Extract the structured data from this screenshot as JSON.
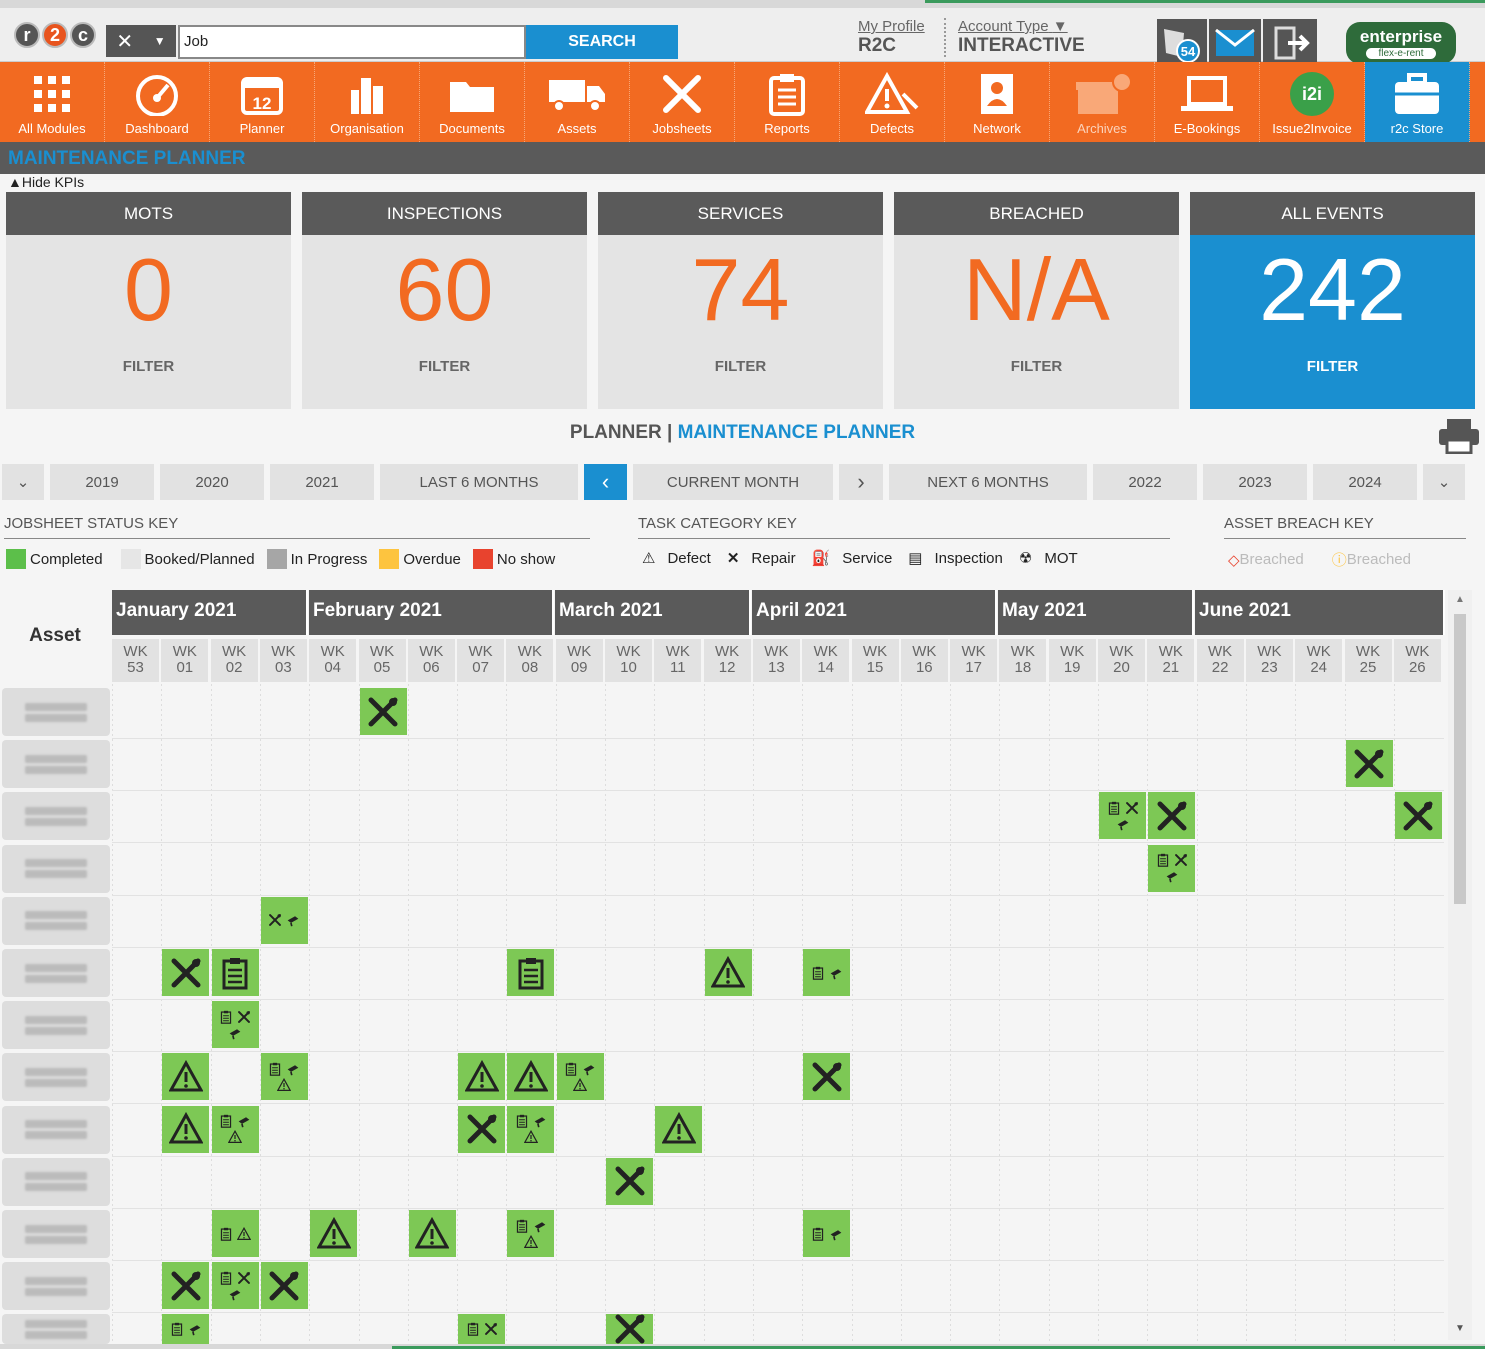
{
  "header": {
    "search_value": "Job",
    "search_button": "SEARCH",
    "my_profile_label": "My Profile",
    "profile_value": "R2C",
    "account_type_label": "Account Type",
    "account_type_value": "INTERACTIVE",
    "notifications_count": "54",
    "enterprise_line1": "enterprise",
    "enterprise_line2": "flex-e-rent",
    "logo": "r2c"
  },
  "nav": [
    "All Modules",
    "Dashboard",
    "Planner",
    "Organisation",
    "Documents",
    "Assets",
    "Jobsheets",
    "Reports",
    "Defects",
    "Network",
    "Archives",
    "E-Bookings",
    "Issue2Invoice",
    "r2c Store"
  ],
  "nav_icons": [
    "grid-icon",
    "speedometer-icon",
    "calendar-icon",
    "building-icon",
    "folder-icon",
    "truck-icon",
    "tools-icon",
    "clipboard-icon",
    "warning-icon",
    "contact-book-icon",
    "archive-icon",
    "laptop-icon",
    "i2i-icon",
    "briefcase-icon"
  ],
  "page_title": "MAINTENANCE PLANNER",
  "hide_kpis": "Hide KPIs",
  "kpis": [
    {
      "title": "MOTS",
      "value": "0",
      "filter": "FILTER"
    },
    {
      "title": "INSPECTIONS",
      "value": "60",
      "filter": "FILTER"
    },
    {
      "title": "SERVICES",
      "value": "74",
      "filter": "FILTER"
    },
    {
      "title": "BREACHED",
      "value": "N/A",
      "filter": "FILTER"
    },
    {
      "title": "ALL EVENTS",
      "value": "242",
      "filter": "FILTER"
    }
  ],
  "planner_title_a": "PLANNER | ",
  "planner_title_b": "MAINTENANCE PLANNER",
  "range_buttons": {
    "y2019": "2019",
    "y2020": "2020",
    "y2021": "2021",
    "last6": "LAST 6 MONTHS",
    "current": "CURRENT MONTH",
    "next6": "NEXT 6 MONTHS",
    "y2022": "2022",
    "y2023": "2023",
    "y2024": "2024"
  },
  "keys": {
    "status_title": "JOBSHEET STATUS KEY",
    "task_title": "TASK CATEGORY KEY",
    "breach_title": "ASSET BREACH KEY",
    "status": [
      {
        "label": "Completed",
        "color": "#5cbf4a"
      },
      {
        "label": "Booked/Planned",
        "color": "#e6e6e6"
      },
      {
        "label": "In Progress",
        "color": "#a6a6a6"
      },
      {
        "label": "Overdue",
        "color": "#fdc43f"
      },
      {
        "label": "No show",
        "color": "#e8432e"
      }
    ],
    "task": [
      "Defect",
      "Repair",
      "Service",
      "Inspection",
      "MOT"
    ],
    "breach": [
      "Breached",
      "Breached"
    ]
  },
  "asset_header": "Asset",
  "months": [
    "January 2021",
    "February 2021",
    "March 2021",
    "April 2021",
    "May 2021",
    "June 2021"
  ],
  "weeks": [
    "53",
    "01",
    "02",
    "03",
    "04",
    "05",
    "06",
    "07",
    "08",
    "09",
    "10",
    "11",
    "12",
    "13",
    "14",
    "15",
    "16",
    "17",
    "18",
    "19",
    "20",
    "21",
    "22",
    "23",
    "24",
    "25",
    "26"
  ],
  "wk_label": "WK",
  "colors": {
    "orange": "#f26a21",
    "blue": "#1a8fd0",
    "green": "#7dc855",
    "header_gray": "#5a5a5a"
  },
  "events": [
    {
      "row": 0,
      "week": 5,
      "icons": [
        "R"
      ]
    },
    {
      "row": 1,
      "week": 25,
      "icons": [
        "R"
      ]
    },
    {
      "row": 2,
      "week": 20,
      "icons": [
        "I",
        "r",
        "s"
      ]
    },
    {
      "row": 2,
      "week": 21,
      "icons": [
        "R"
      ]
    },
    {
      "row": 2,
      "week": 26,
      "icons": [
        "R"
      ]
    },
    {
      "row": 3,
      "week": 21,
      "icons": [
        "I",
        "r",
        "s"
      ]
    },
    {
      "row": 4,
      "week": 3,
      "icons": [
        "r",
        "s"
      ]
    },
    {
      "row": 5,
      "week": 1,
      "icons": [
        "R"
      ]
    },
    {
      "row": 5,
      "week": 2,
      "icons": [
        "IB"
      ]
    },
    {
      "row": 5,
      "week": 8,
      "icons": [
        "IB"
      ]
    },
    {
      "row": 5,
      "week": 12,
      "icons": [
        "D"
      ]
    },
    {
      "row": 5,
      "week": 14,
      "icons": [
        "I",
        "s"
      ]
    },
    {
      "row": 6,
      "week": 2,
      "icons": [
        "I",
        "r",
        "s"
      ]
    },
    {
      "row": 7,
      "week": 1,
      "icons": [
        "D"
      ]
    },
    {
      "row": 7,
      "week": 3,
      "icons": [
        "I",
        "s",
        "d"
      ]
    },
    {
      "row": 7,
      "week": 7,
      "icons": [
        "D"
      ]
    },
    {
      "row": 7,
      "week": 8,
      "icons": [
        "D"
      ]
    },
    {
      "row": 7,
      "week": 9,
      "icons": [
        "I",
        "s",
        "d"
      ]
    },
    {
      "row": 7,
      "week": 14,
      "icons": [
        "R"
      ]
    },
    {
      "row": 8,
      "week": 1,
      "icons": [
        "D"
      ]
    },
    {
      "row": 8,
      "week": 2,
      "icons": [
        "I",
        "s",
        "d"
      ]
    },
    {
      "row": 8,
      "week": 7,
      "icons": [
        "R"
      ]
    },
    {
      "row": 8,
      "week": 8,
      "icons": [
        "I",
        "s",
        "d"
      ]
    },
    {
      "row": 8,
      "week": 11,
      "icons": [
        "D"
      ]
    },
    {
      "row": 9,
      "week": 10,
      "icons": [
        "R"
      ]
    },
    {
      "row": 10,
      "week": 2,
      "icons": [
        "I",
        "d"
      ]
    },
    {
      "row": 10,
      "week": 4,
      "icons": [
        "D"
      ]
    },
    {
      "row": 10,
      "week": 6,
      "icons": [
        "D"
      ]
    },
    {
      "row": 10,
      "week": 8,
      "icons": [
        "I",
        "s",
        "d"
      ]
    },
    {
      "row": 10,
      "week": 14,
      "icons": [
        "I",
        "s"
      ]
    },
    {
      "row": 11,
      "week": 1,
      "icons": [
        "R"
      ]
    },
    {
      "row": 11,
      "week": 2,
      "icons": [
        "I",
        "r",
        "s"
      ]
    },
    {
      "row": 11,
      "week": 3,
      "icons": [
        "R"
      ]
    },
    {
      "row": 12,
      "week": 1,
      "icons": [
        "I",
        "s"
      ]
    },
    {
      "row": 12,
      "week": 7,
      "icons": [
        "I",
        "r"
      ]
    },
    {
      "row": 12,
      "week": 10,
      "icons": [
        "R"
      ]
    }
  ]
}
